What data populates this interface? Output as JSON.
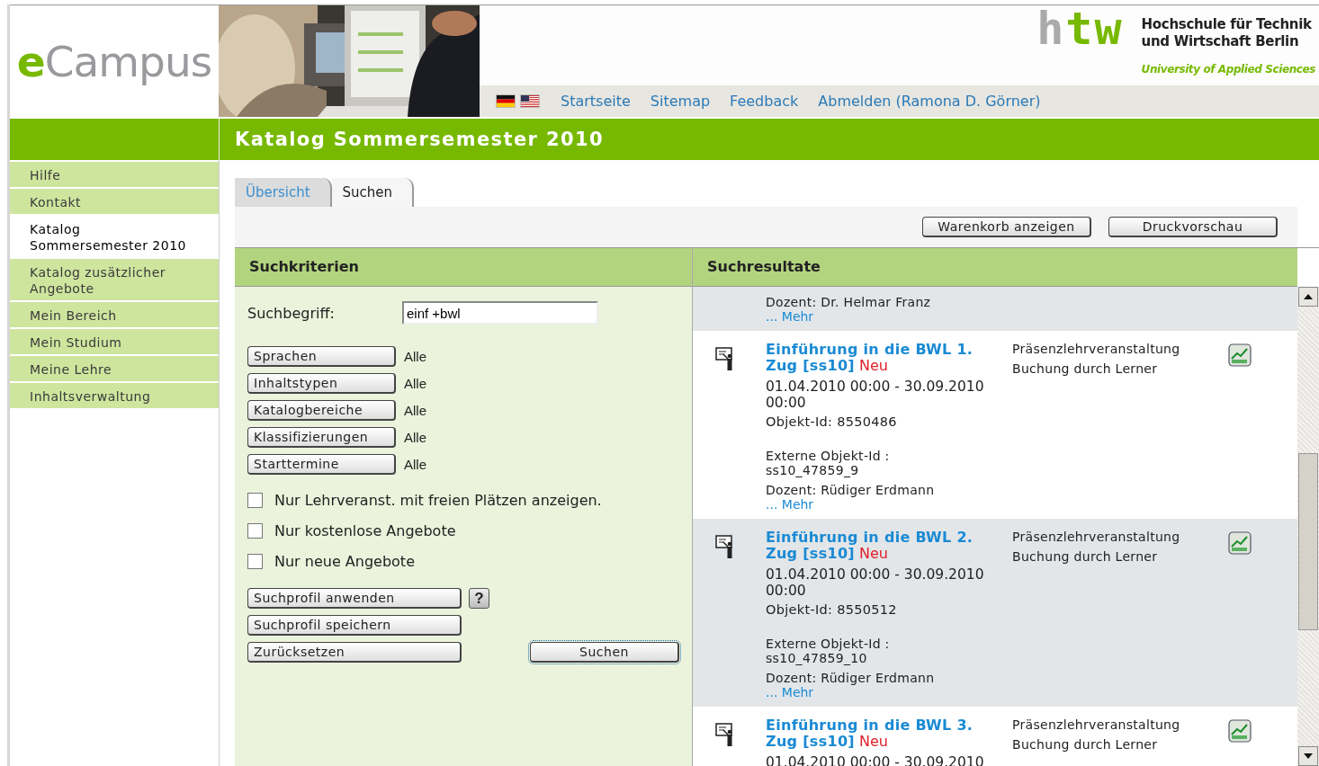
{
  "logo": {
    "accent": "e",
    "rest": "Campus"
  },
  "institution": {
    "mark": "htw",
    "name_lines": [
      "Hochschule für Technik",
      "und Wirtschaft Berlin"
    ],
    "tagline": "University of Applied Sciences"
  },
  "nav": {
    "links": [
      "Startseite",
      "Sitemap",
      "Feedback",
      "Abmelden (Ramona D. Görner)"
    ]
  },
  "page_title": "Katalog Sommersemester 2010",
  "sidebar": {
    "items": [
      {
        "label": "Hilfe",
        "selected": false
      },
      {
        "label": "Kontakt",
        "selected": false
      },
      {
        "label": "Katalog Sommersemester 2010",
        "selected": true
      },
      {
        "label": "Katalog zusätzlicher Angebote",
        "selected": false
      },
      {
        "label": "Mein Bereich",
        "selected": false
      },
      {
        "label": "Mein Studium",
        "selected": false
      },
      {
        "label": "Meine Lehre",
        "selected": false
      },
      {
        "label": "Inhaltsverwaltung",
        "selected": false
      }
    ]
  },
  "tabs": [
    {
      "label": "Übersicht",
      "selected": false
    },
    {
      "label": "Suchen",
      "selected": true
    }
  ],
  "toolbar": {
    "buttons": [
      "Warenkorb anzeigen",
      "Druckvorschau"
    ]
  },
  "criteria": {
    "title": "Suchkriterien",
    "search_label": "Suchbegriff:",
    "search_value": "einf +bwl",
    "filters": [
      {
        "button": "Sprachen",
        "value": "Alle"
      },
      {
        "button": "Inhaltstypen",
        "value": "Alle"
      },
      {
        "button": "Katalogbereiche",
        "value": "Alle"
      },
      {
        "button": "Klassifizierungen",
        "value": "Alle"
      },
      {
        "button": "Starttermine",
        "value": "Alle"
      }
    ],
    "options": [
      {
        "label": "Nur Lehrveranst. mit freien Plätzen anzeigen.",
        "checked": false
      },
      {
        "label": "Nur kostenlose Angebote",
        "checked": false
      },
      {
        "label": "Nur neue Angebote",
        "checked": false
      }
    ],
    "profile_buttons": [
      {
        "label": "Suchprofil anwenden",
        "help": "?"
      },
      {
        "label": "Suchprofil speichern"
      }
    ],
    "reset_button": "Zurücksetzen",
    "search_button": {
      "label": "Suchen",
      "focused": true
    }
  },
  "results": {
    "title": "Suchresultate",
    "items": [
      {
        "shaded": true,
        "lecturer": "Dozent: Dr. Helmar Franz",
        "more": "... Mehr"
      },
      {
        "shaded": false,
        "title": "Einführung in die BWL 1. Zug [ss10]",
        "badge": "Neu",
        "date_lines": [
          "01.04.2010 00:00 - 30.09.2010",
          "00:00"
        ],
        "object_id": "Objekt-Id: 8550486",
        "external_id_label": "Externe Objekt-Id :",
        "external_id": "ss10_47859_9",
        "lecturer": "Dozent: Rüdiger Erdmann",
        "more": "... Mehr",
        "type": "Präsenzlehrveranstaltung",
        "booking": "Buchung durch Lerner"
      },
      {
        "shaded": true,
        "title": "Einführung in die BWL 2. Zug [ss10]",
        "badge": "Neu",
        "date_lines": [
          "01.04.2010 00:00 - 30.09.2010",
          "00:00"
        ],
        "object_id": "Objekt-Id: 8550512",
        "external_id_label": "Externe Objekt-Id :",
        "external_id": "ss10_47859_10",
        "lecturer": "Dozent: Rüdiger Erdmann",
        "more": "... Mehr",
        "type": "Präsenzlehrveranstaltung",
        "booking": "Buchung durch Lerner"
      },
      {
        "shaded": false,
        "title": "Einführung in die BWL 3. Zug [ss10]",
        "badge": "Neu",
        "date_lines": [
          "01.04.2010 00:00 - 30.09.2010"
        ],
        "type": "Präsenzlehrveranstaltung",
        "booking": "Buchung durch Lerner"
      }
    ]
  }
}
